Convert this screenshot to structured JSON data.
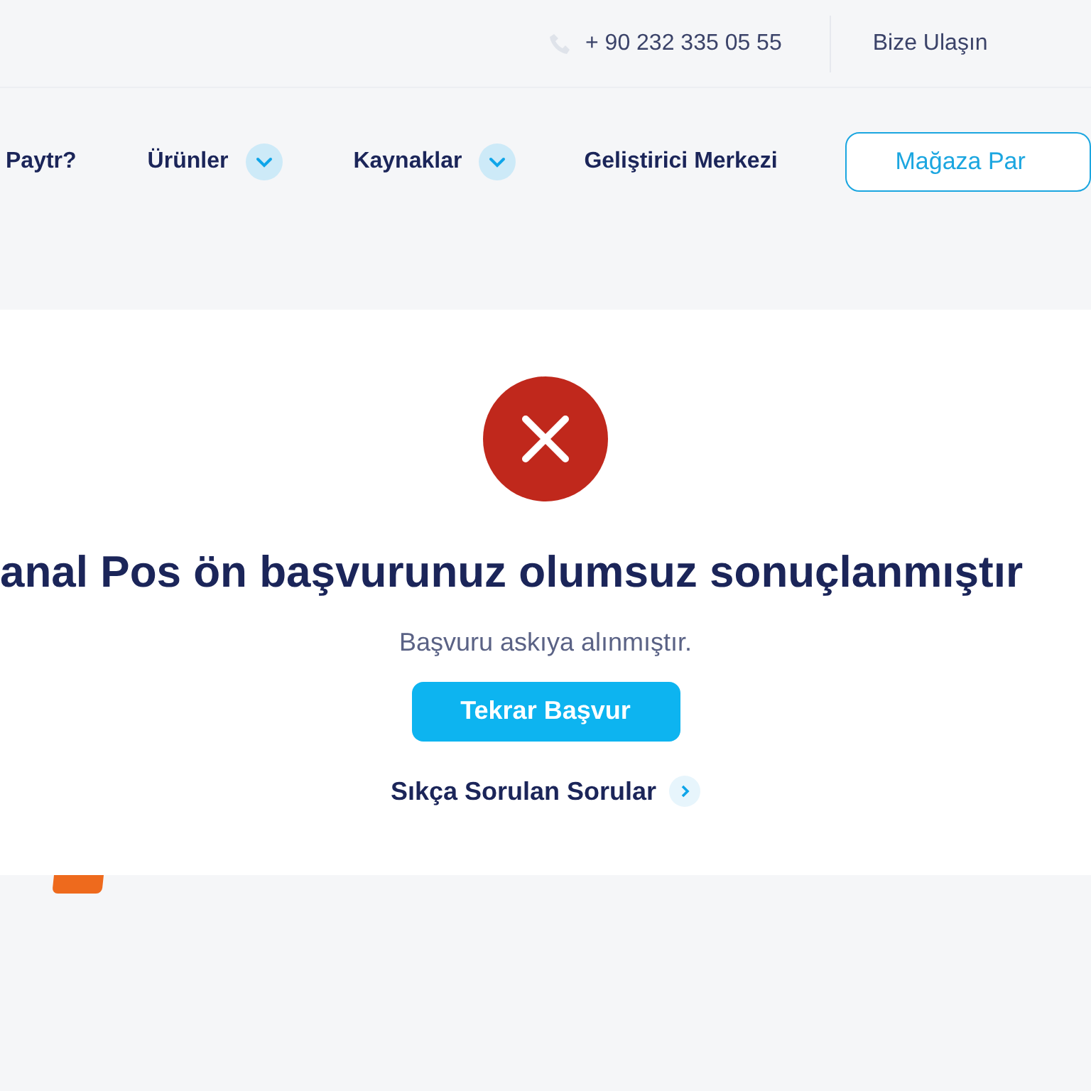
{
  "top_bar": {
    "phone": "+ 90 232 335 05 55",
    "contact_link": "Bize Ulaşın"
  },
  "nav": {
    "items": [
      {
        "label": "Paytr?",
        "kind": "link"
      },
      {
        "label": "Ürünler",
        "kind": "dropdown"
      },
      {
        "label": "Kaynaklar",
        "kind": "dropdown"
      },
      {
        "label": "Geliştirici Merkezi",
        "kind": "link"
      }
    ],
    "store_button": "Mağaza Par"
  },
  "result": {
    "title": "anal Pos ön başvurunuz olumsuz sonuçlanmıştır",
    "message": "Başvuru askıya alınmıştır.",
    "retry_button": "Tekrar Başvur",
    "faq_link": "Sıkça Sorulan Sorular"
  }
}
